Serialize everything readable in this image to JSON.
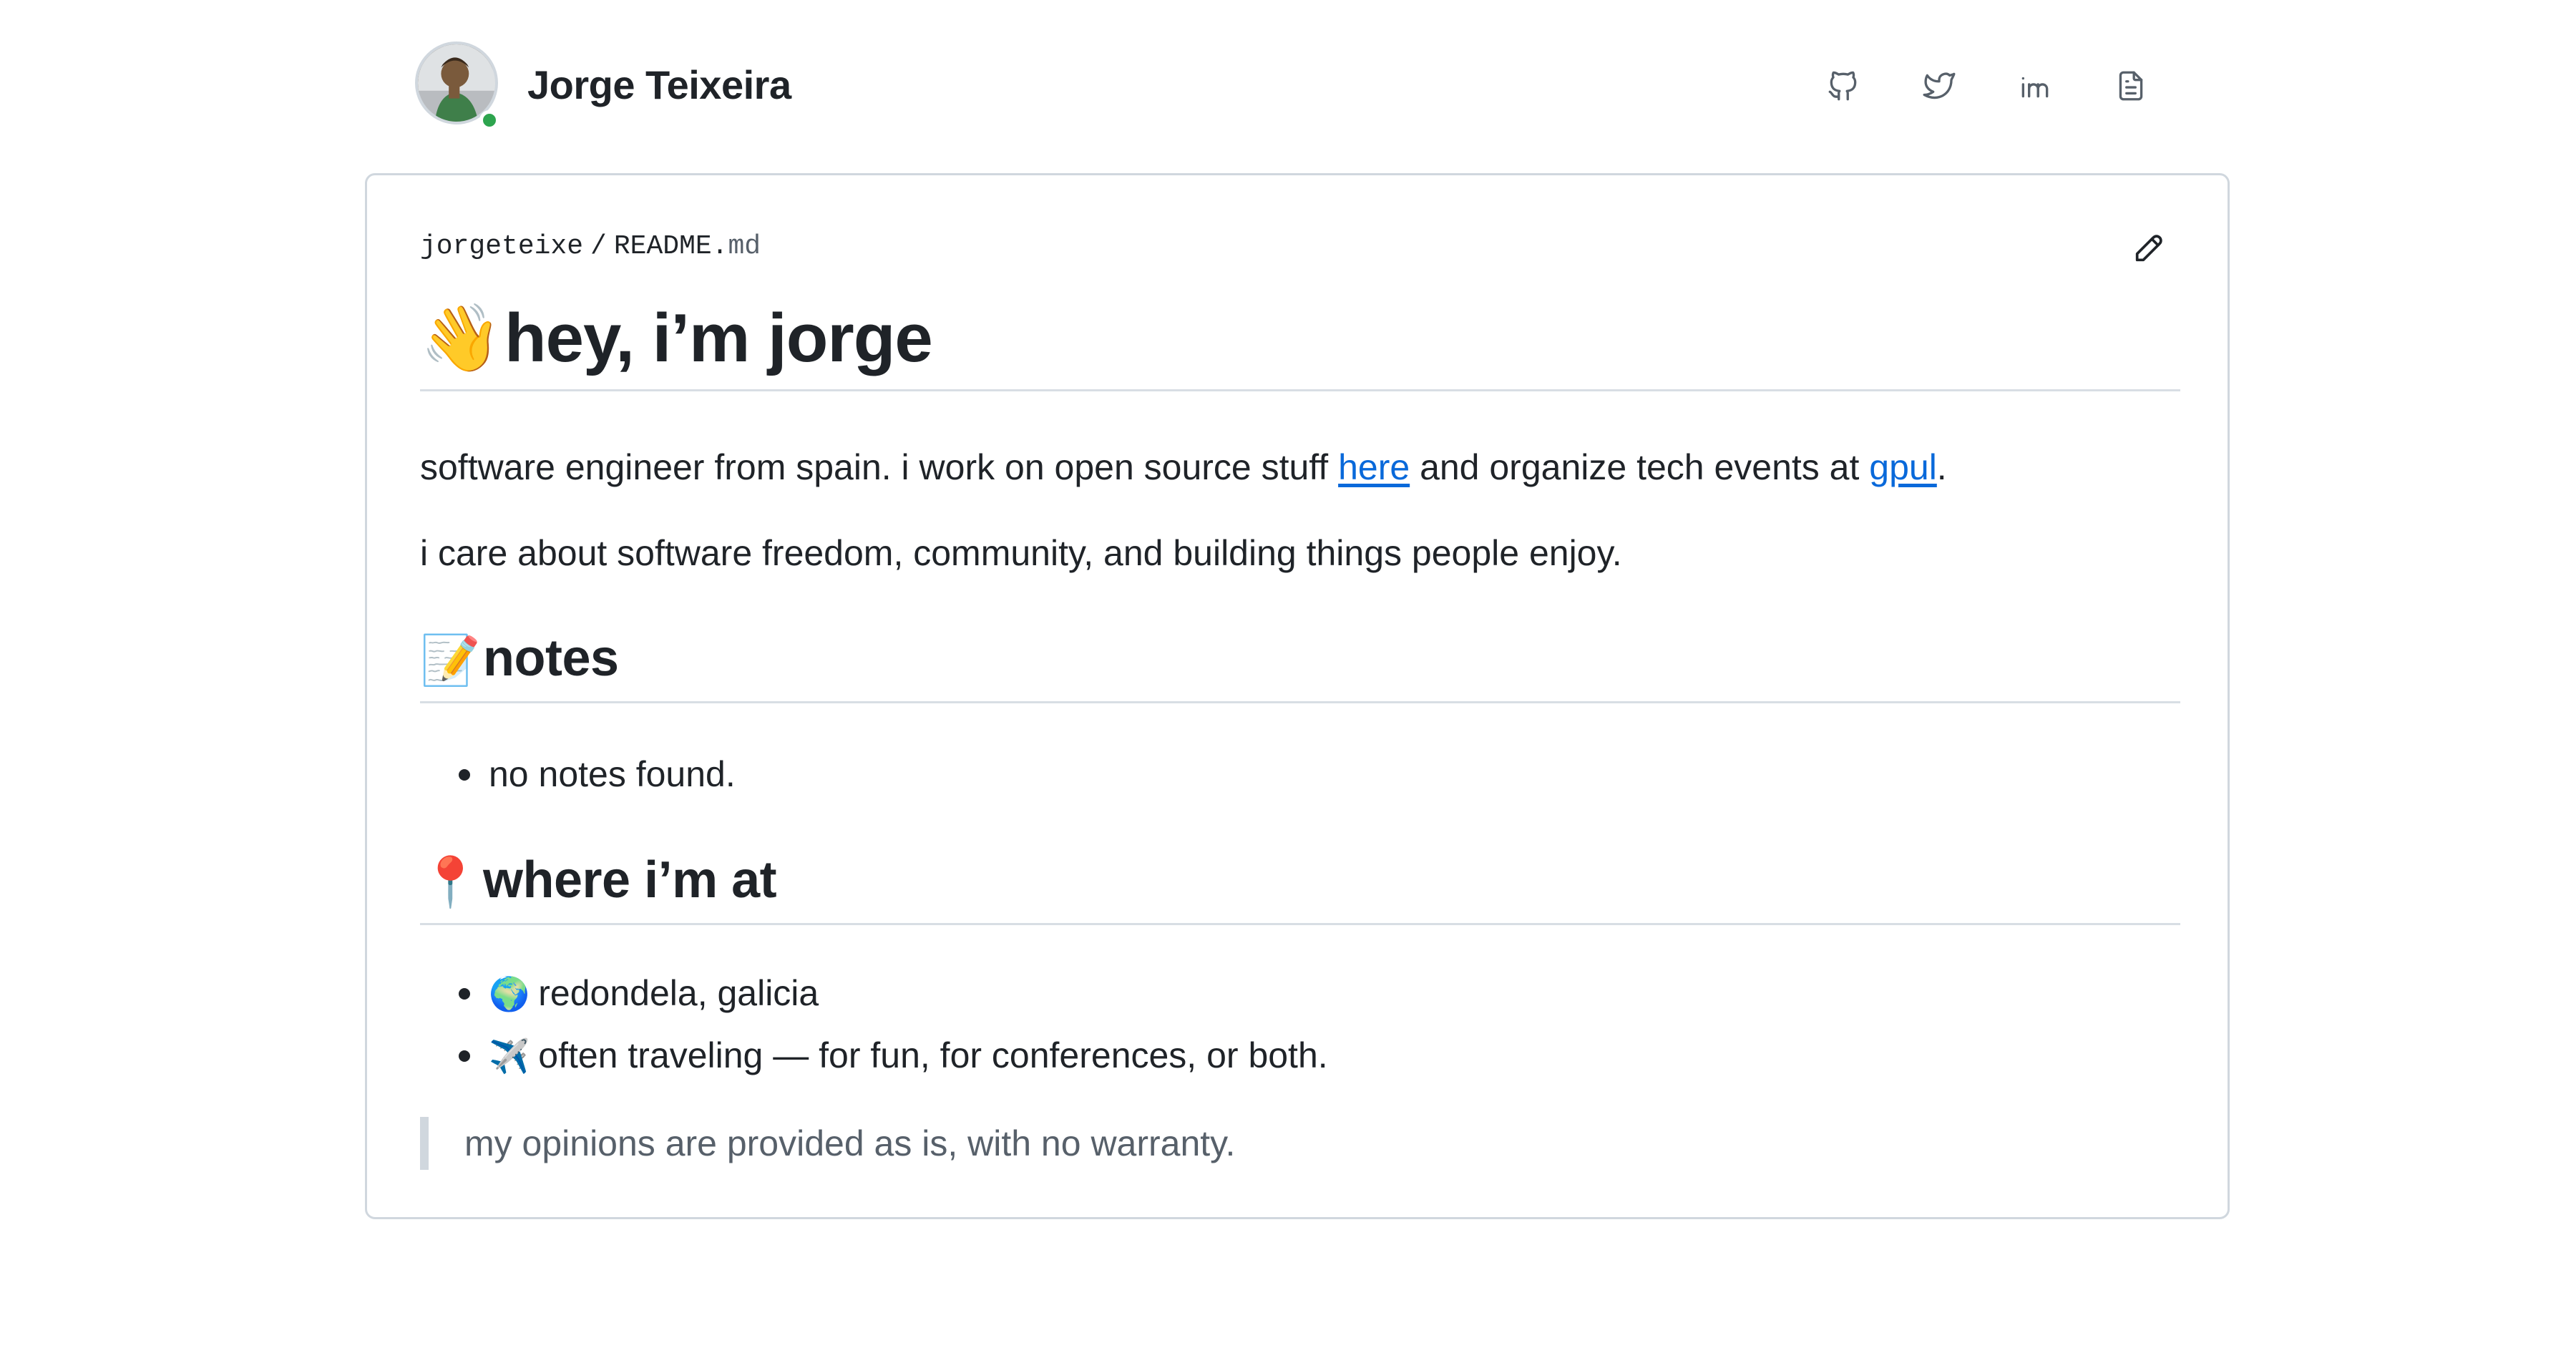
{
  "header": {
    "name": "Jorge Teixeira",
    "avatar_icon": "avatar-photo",
    "status_color": "#2da44e",
    "social": [
      {
        "name": "github-icon",
        "label": "GitHub"
      },
      {
        "name": "twitter-icon",
        "label": "Twitter"
      },
      {
        "name": "linkedin-icon",
        "label": "LinkedIn"
      },
      {
        "name": "document-icon",
        "label": "Resume"
      }
    ]
  },
  "readme": {
    "breadcrumb": {
      "owner": "jorgeteixe",
      "separator": "/",
      "file_base": "README.",
      "file_ext": "md"
    },
    "edit_icon": "pencil-icon",
    "title_emoji": "👋",
    "title": "hey, i’m jorge",
    "intro": {
      "part1": "software engineer from spain. i work on open source stuff ",
      "link1": "here",
      "part2": " and organize tech events at ",
      "link2": "gpul",
      "part3": "."
    },
    "values": "i care about software freedom, community, and building things people enjoy.",
    "notes": {
      "emoji": "📝",
      "heading": "notes",
      "items": [
        "no notes found."
      ]
    },
    "location": {
      "emoji": "📍",
      "heading": "where i’m at",
      "items": [
        {
          "icon": "🌍",
          "text": "redondela, galicia"
        },
        {
          "icon": "✈️",
          "text": "often traveling — for fun, for conferences, or both."
        }
      ]
    },
    "disclaimer": "my opinions are provided as is, with no warranty."
  },
  "colors": {
    "link": "#0969da",
    "text": "#1f2328",
    "muted": "#57606a",
    "border": "#d0d7de"
  }
}
